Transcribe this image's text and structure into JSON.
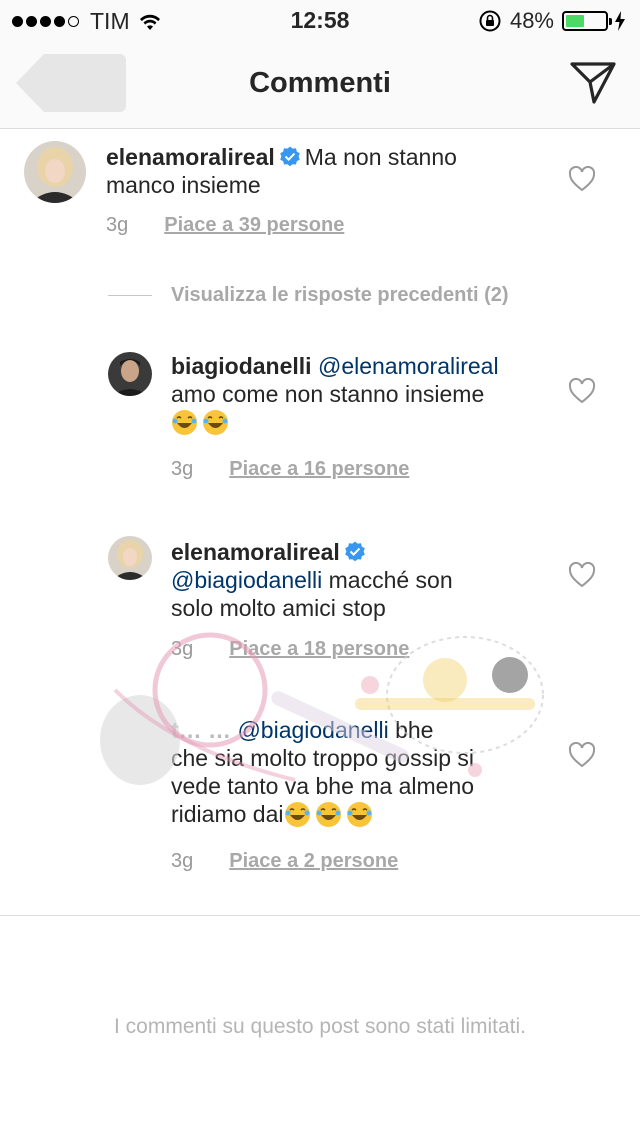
{
  "status_bar": {
    "carrier": "TIM",
    "time": "12:58",
    "battery_percent": "48%",
    "battery_level": 0.48,
    "signal_dots": 5,
    "signal_filled": 4
  },
  "header": {
    "title": "Commenti",
    "back_icon": "back-arrow-icon",
    "send_icon": "paper-plane-icon"
  },
  "comments": [
    {
      "username": "elenamoralireal",
      "verified": true,
      "text": "Ma non stanno",
      "text_line2": "manco insieme",
      "time": "3g",
      "likes": "Piace a 39 persone"
    }
  ],
  "view_replies": "Visualizza le risposte precedenti (2)",
  "replies": [
    {
      "username": "biagiodanelli",
      "mention": "@elenamoralireal",
      "text_line2": "amo come non stanno insieme",
      "emojis": "😂😂",
      "time": "3g",
      "likes": "Piace a 16 persone"
    },
    {
      "username": "elenamoralireal",
      "verified": true,
      "mention": "@biagiodanelli",
      "text_line1_rest": " macché son",
      "text_line2": "solo molto amici stop",
      "time": "3g",
      "likes": "Piace a 18 persone"
    },
    {
      "username": "",
      "mention": "@biagiodanelli",
      "text_line1_rest": " bhe",
      "text_line2": "che sia molto troppo gossip si",
      "text_line3": "vede tanto va bhe ma almeno",
      "text_line4": "ridiamo dai",
      "emojis": "😂😂😂",
      "time": "3g",
      "likes": "Piace a 2 persone"
    }
  ],
  "footer_note": "I commenti su questo post sono stati limitati.",
  "colors": {
    "accent_mention": "#003569",
    "verified_blue": "#3897f0",
    "battery_green": "#4cd964",
    "meta_gray": "#999999"
  }
}
